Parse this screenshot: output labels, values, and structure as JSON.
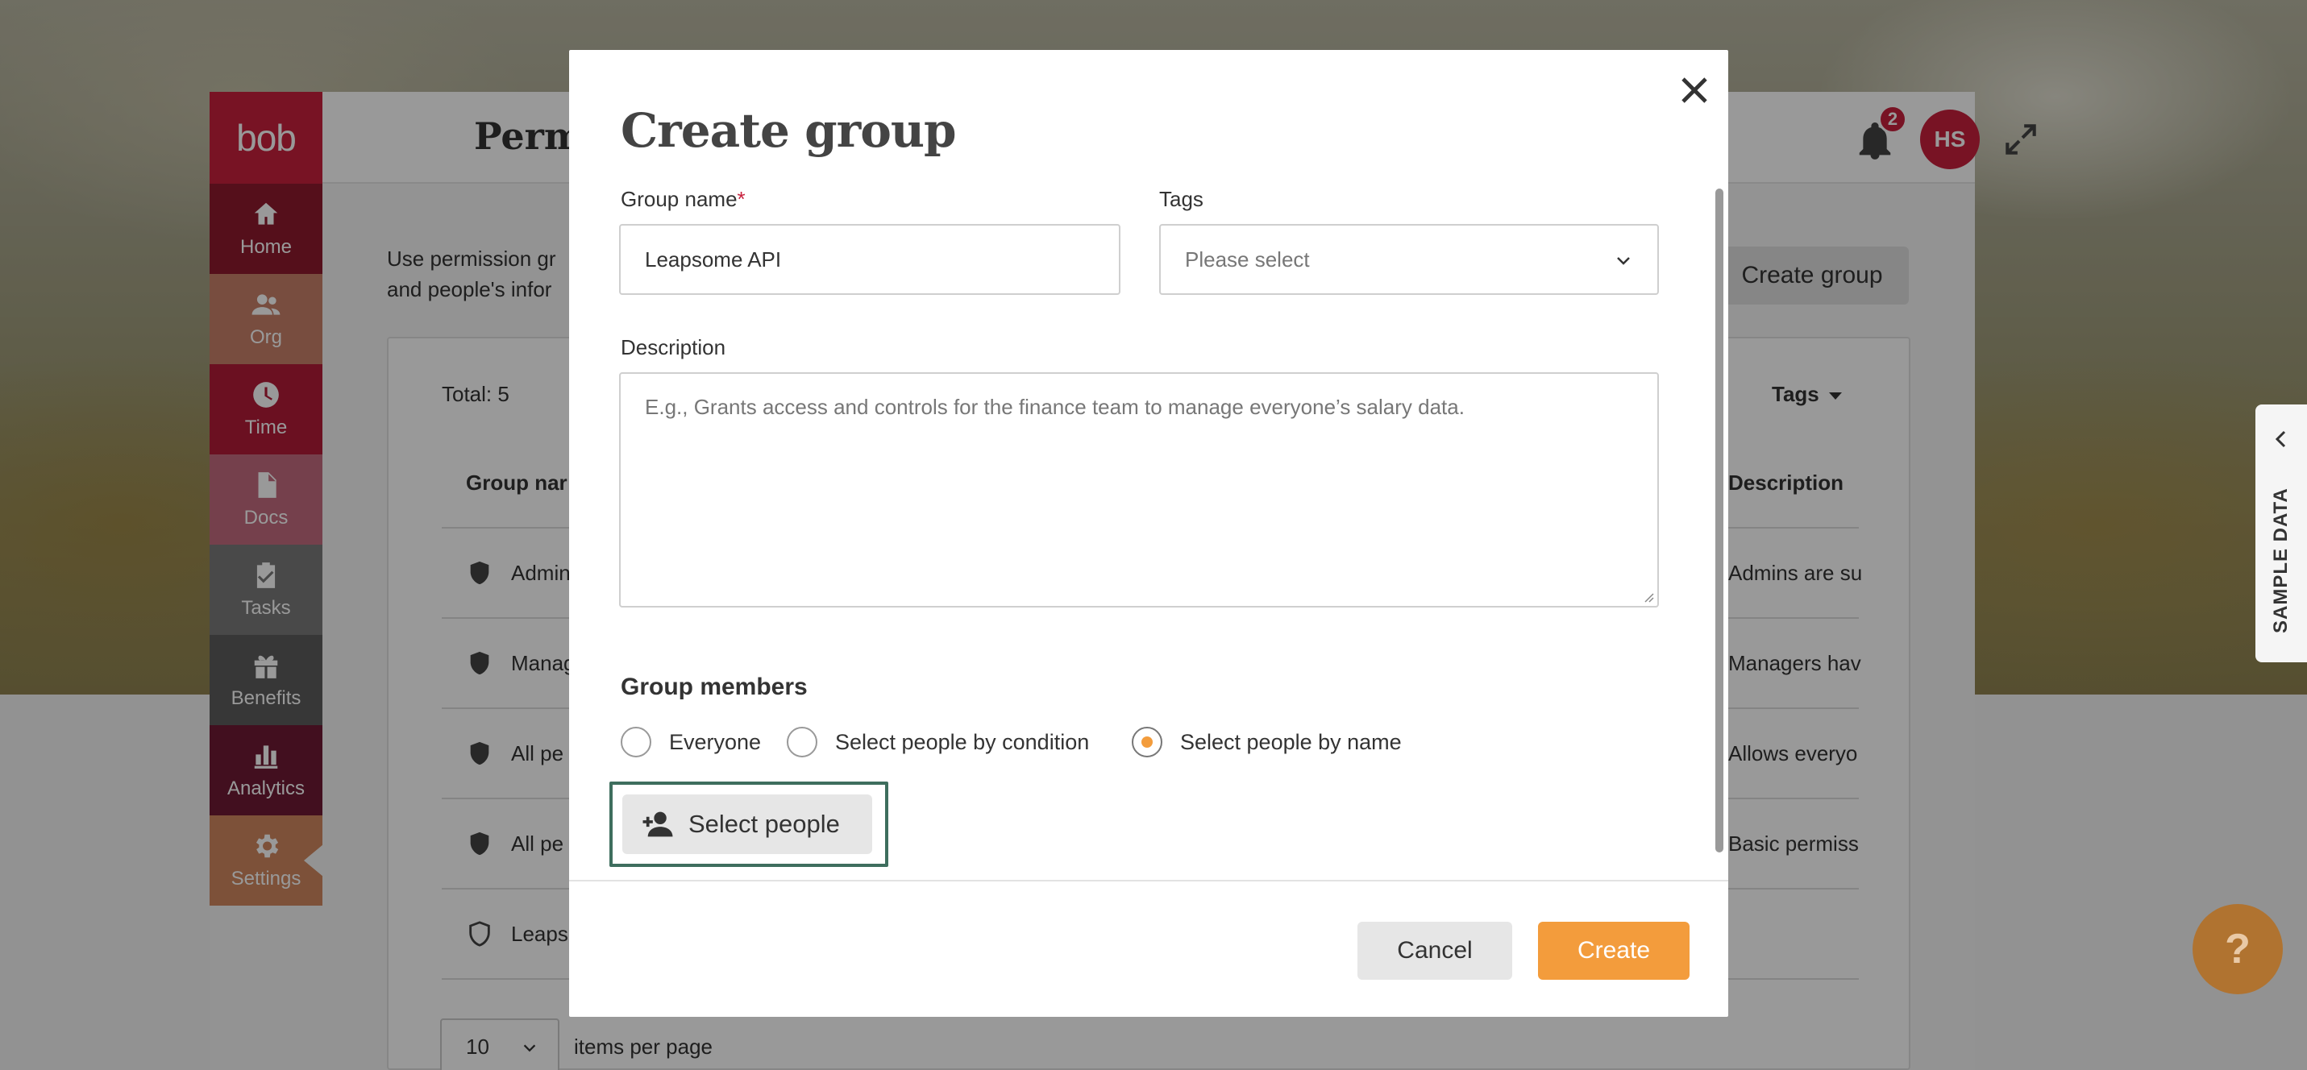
{
  "app": {
    "logo": "bob",
    "page_title": "Permissions",
    "notification_count": "2",
    "avatar_initials": "HS"
  },
  "sidebar": {
    "items": [
      {
        "label": "Home",
        "icon": "home-icon"
      },
      {
        "label": "Org",
        "icon": "people-icon"
      },
      {
        "label": "Time",
        "icon": "clock-icon"
      },
      {
        "label": "Docs",
        "icon": "document-icon"
      },
      {
        "label": "Tasks",
        "icon": "clipboard-check-icon"
      },
      {
        "label": "Benefits",
        "icon": "gift-icon"
      },
      {
        "label": "Analytics",
        "icon": "bar-chart-icon"
      },
      {
        "label": "Settings",
        "icon": "gear-icon"
      }
    ]
  },
  "page": {
    "intro_line1": "Use permission gr",
    "intro_line2": "and people's infor",
    "create_group_label": "Create group",
    "total": "Total: 5",
    "tags_filter": "Tags",
    "columns": {
      "name": "Group nar",
      "description": "Description"
    },
    "rows": [
      {
        "name": "Admin",
        "description": "Admins are su"
      },
      {
        "name": "Manag",
        "description": "Managers hav"
      },
      {
        "name": "All pe",
        "description": "Allows everyo"
      },
      {
        "name": "All pe",
        "description": "Basic permiss"
      },
      {
        "name": "Leaps",
        "description": ""
      }
    ],
    "per_page_value": "10",
    "per_page_label": "items per page"
  },
  "modal": {
    "title": "Create group",
    "group_name_label": "Group name",
    "required_mark": "*",
    "group_name_value": "Leapsome API",
    "tags_label": "Tags",
    "tags_placeholder": "Please select",
    "description_label": "Description",
    "description_placeholder": "E.g., Grants access and controls for the finance team to manage everyone’s salary data.",
    "members_title": "Group members",
    "radio_options": [
      {
        "label": "Everyone",
        "selected": false
      },
      {
        "label": "Select people by condition",
        "selected": false
      },
      {
        "label": "Select people by name",
        "selected": true
      }
    ],
    "select_people_label": "Select people",
    "cancel_label": "Cancel",
    "create_label": "Create"
  },
  "side": {
    "sample_data_label": "SAMPLE DATA",
    "help_label": "?"
  },
  "colors": {
    "brand": "#c8203c",
    "accent": "#f39c3c",
    "focus_outline": "#3e6e5e"
  }
}
